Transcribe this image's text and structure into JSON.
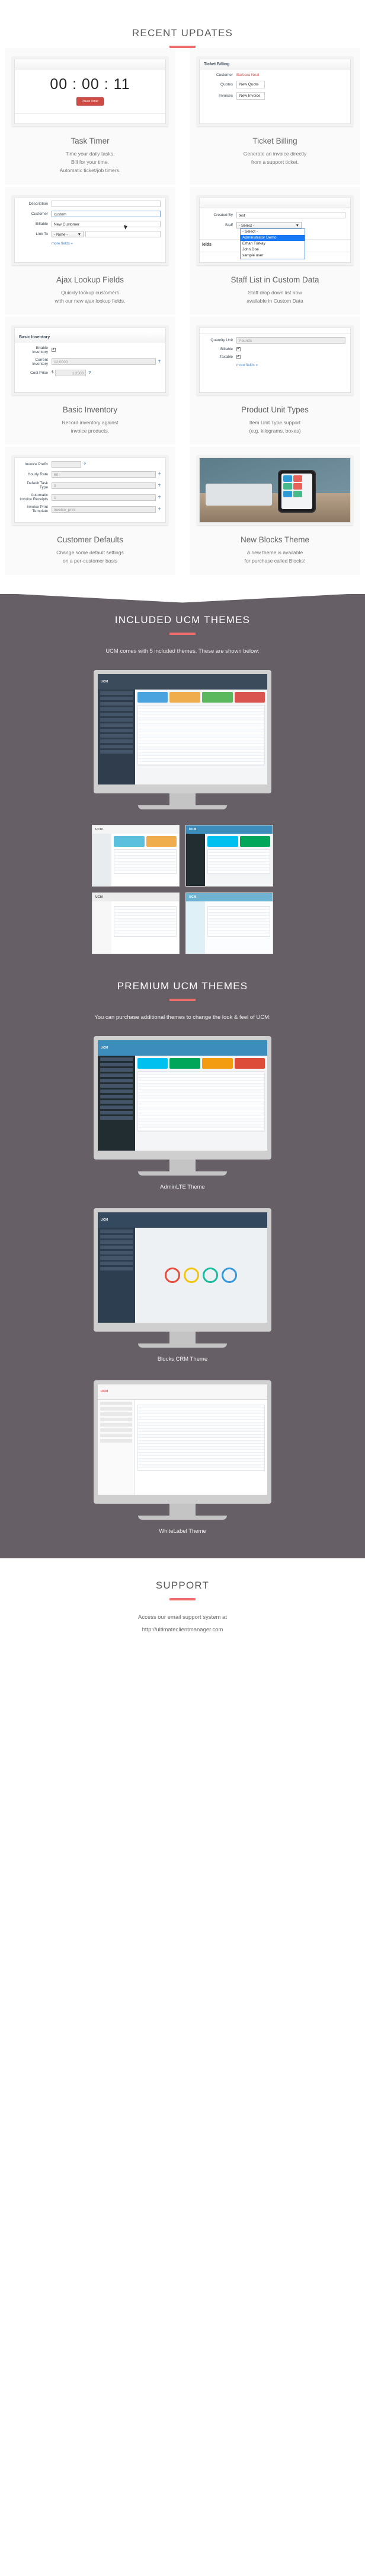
{
  "recent": {
    "title": "RECENT UPDATES",
    "features": [
      {
        "title": "Task Timer",
        "desc": "Time your daily tasks.\nBill for your time.\nAutomatic ticket/job timers.",
        "shot": {
          "timer": "00 : 00 : 11",
          "button": "Pause Timer"
        }
      },
      {
        "title": "Ticket Billing",
        "desc": "Generate an invoice directly\nfrom a support ticket.",
        "shot": {
          "panel_title": "Ticket Billing",
          "rows": [
            {
              "label": "Customer",
              "value": "Barbara Neal"
            },
            {
              "label": "Quotes",
              "value": "New Quote"
            },
            {
              "label": "Invoices",
              "value": "New Invoice"
            }
          ]
        }
      },
      {
        "title": "Ajax Lookup Fields",
        "desc": "Quickly lookup customers\nwith our new ajax lookup fields.",
        "shot": {
          "label_description": "Description",
          "label_customer": "Customer",
          "value_customer": "custom",
          "suggestion": "New Customer",
          "label_billable": "Billable",
          "label_linkto": "Link To",
          "value_linkto": "- None -",
          "more": "more fields »"
        }
      },
      {
        "title": "Staff List in Custom Data",
        "desc": "Staff drop down list now\navailable in Custom Data",
        "shot": {
          "label_created_by": "Created By",
          "value_created_by": "test",
          "label_staff": "Staff",
          "value_staff": "- Select -",
          "options": [
            "- Select -",
            "Administrator Demo",
            "Erhan Türkay",
            "John Doe",
            "sample user"
          ],
          "selected_option": "Administrator Demo",
          "side_text": "ields"
        }
      },
      {
        "title": "Basic Inventory",
        "desc": "Record inventory against\ninvoice products.",
        "shot": {
          "panel_title": "Basic Inventory",
          "rows": [
            {
              "label": "Enable Inventory",
              "value": ""
            },
            {
              "label": "Current Inventory",
              "value": "12.0000"
            },
            {
              "label": "Cost Price",
              "value": "1.2500",
              "prefix": "$"
            }
          ]
        }
      },
      {
        "title": "Product Unit Types",
        "desc": "Item Unit Type support\n(e.g. kilograms, boxes)",
        "shot": {
          "rows": [
            {
              "label": "Quantity Unit",
              "value": "Pounds"
            },
            {
              "label": "Billable",
              "value": ""
            },
            {
              "label": "Taxable",
              "value": ""
            }
          ],
          "more": "more fields »"
        }
      },
      {
        "title": "Customer Defaults",
        "desc": "Change some default settings\non a per-customer basis",
        "shot": {
          "rows": [
            {
              "label": "Invoice Prefix",
              "value": ""
            },
            {
              "label": "Hourly Rate",
              "value": "60"
            },
            {
              "label": "Default Task Type",
              "value": "0"
            },
            {
              "label": "Automatic Invoice Receipts",
              "value": "1"
            },
            {
              "label": "Invoice Print Template",
              "value": "invoice_print"
            }
          ]
        }
      },
      {
        "title": "New Blocks Theme",
        "desc": "A new theme is available\nfor purchase called Blocks!",
        "shot": {
          "kind": "photo-phone-blocks"
        }
      }
    ]
  },
  "included": {
    "title": "INCLUDED UCM THEMES",
    "subtitle": "UCM comes with 5 included themes. These are shown below:"
  },
  "premium": {
    "title": "PREMIUM UCM THEMES",
    "subtitle": "You can purchase additional themes to change the look & feel of UCM:",
    "themes": [
      {
        "caption": "AdminLTE Theme"
      },
      {
        "caption": "Blocks CRM Theme"
      },
      {
        "caption": "WhiteLabel Theme"
      }
    ]
  },
  "support": {
    "title": "SUPPORT",
    "line1": "Access our email support system at",
    "line2": "http://ultimateclientmanager.com"
  },
  "colors": {
    "accent": "#ef6d6d",
    "band": "#665f65",
    "heading": "#5a5a5a"
  }
}
